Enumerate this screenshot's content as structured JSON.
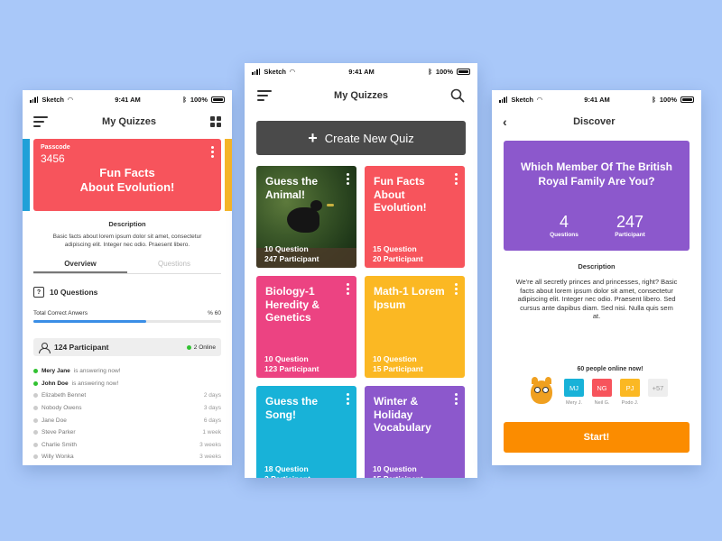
{
  "status": {
    "carrier": "Sketch",
    "time": "9:41 AM",
    "battery": "100%"
  },
  "screen1": {
    "title": "My Quizzes",
    "card": {
      "passcode_label": "Passcode",
      "passcode": "3456",
      "title_line1": "Fun Facts",
      "title_line2": "About Evolution!",
      "color": "#f7545c"
    },
    "description_heading": "Description",
    "description": "Basic facts about lorem ipsum dolor sit amet, consectetur adipiscing elit. Integer nec odio. Praesent libero.",
    "tabs": [
      "Overview",
      "Questions"
    ],
    "questions_count": "10 Questions",
    "progress_label": "Total Correct Anwers",
    "progress_value": "% 60",
    "progress_fraction": 0.6,
    "participants_label": "124 Participant",
    "online_label": "2 Online",
    "participants": [
      {
        "name": "Mery Jane",
        "status": "is answering now!",
        "online": true,
        "time": ""
      },
      {
        "name": "John Doe",
        "status": "is answering now!",
        "online": true,
        "time": ""
      },
      {
        "name": "Elizabeth Bennet",
        "status": "",
        "online": false,
        "time": "2 days"
      },
      {
        "name": "Nobody Owens",
        "status": "",
        "online": false,
        "time": "3 days"
      },
      {
        "name": "Jane Doe",
        "status": "",
        "online": false,
        "time": "6 days"
      },
      {
        "name": "Steve Parker",
        "status": "",
        "online": false,
        "time": "1 week"
      },
      {
        "name": "Charlie Smith",
        "status": "",
        "online": false,
        "time": "3 weeks"
      },
      {
        "name": "Willy Wonka",
        "status": "",
        "online": false,
        "time": "3 weeks"
      }
    ]
  },
  "screen2": {
    "title": "My Quizzes",
    "create_label": "Create New Quiz",
    "quizzes": [
      {
        "title": "Guess the Animal!",
        "questions": "10 Question",
        "participants": "247 Participant",
        "color": "#2c4a22"
      },
      {
        "title": "Fun Facts About Evolution!",
        "questions": "15 Question",
        "participants": "20 Participant",
        "color": "#f7545c"
      },
      {
        "title": "Biology-1 Heredity & Genetics",
        "questions": "10 Question",
        "participants": "123 Participant",
        "color": "#ec4382"
      },
      {
        "title": "Math-1 Lorem Ipsum",
        "questions": "10 Question",
        "participants": "15 Participant",
        "color": "#fbb823"
      },
      {
        "title": "Guess the Song!",
        "questions": "18 Question",
        "participants": "3 Participant",
        "color": "#18b2d8"
      },
      {
        "title": "Winter & Holiday Vocabulary",
        "questions": "10 Question",
        "participants": "15 Participant",
        "color": "#8c58cc"
      }
    ]
  },
  "screen3": {
    "title": "Discover",
    "card_title": "Which Member Of The British Royal Family Are You?",
    "questions_value": "4",
    "questions_label": "Questions",
    "participants_value": "247",
    "participants_label": "Participant",
    "description_heading": "Description",
    "description": "We're all secretly princes and princesses, right? Basic facts about lorem ipsum dolor sit amet, consectetur adipiscing elit. Integer nec odio. Praesent libero. Sed cursus ante dapibus diam. Sed nisi. Nulla quis sem at.",
    "online_text": "60 people online now!",
    "avatars": [
      {
        "initials": "MJ",
        "name": "Mery J.",
        "color": "#18b2d8"
      },
      {
        "initials": "NG",
        "name": "Neil G.",
        "color": "#f7545c"
      },
      {
        "initials": "PJ",
        "name": "Podo J.",
        "color": "#fbb823"
      }
    ],
    "more": "+57",
    "start_label": "Start!",
    "card_color": "#8c58cc",
    "button_color": "#fb8c00"
  }
}
